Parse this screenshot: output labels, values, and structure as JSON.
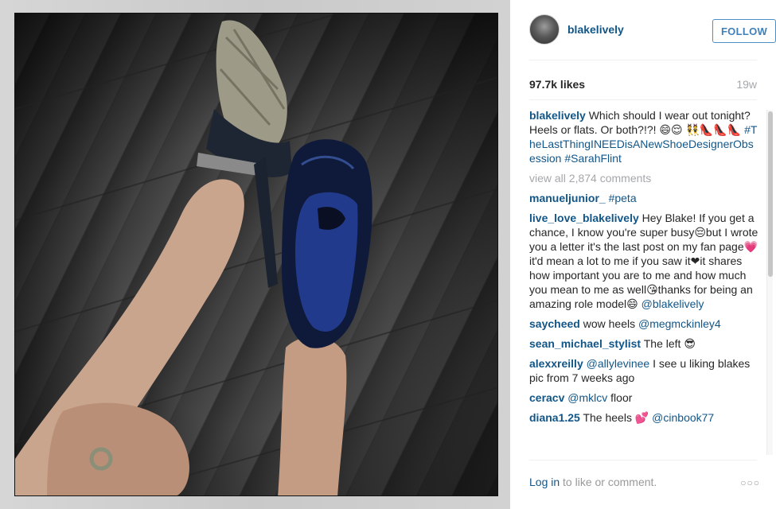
{
  "post": {
    "username": "blakelively",
    "follow_label": "FOLLOW",
    "likes": "97.7k likes",
    "age": "19w"
  },
  "caption": {
    "username": "blakelively",
    "text": "Which should I wear out tonight? Heels or flats. Or both?!?!",
    "emoji": "😄😌 👯👠👠👠",
    "hashtags": "#TheLastThingINEEDisANewShoeDesignerObsession #SarahFlint"
  },
  "view_all": "view all 2,874 comments",
  "comments": [
    {
      "user": "manueljunior_",
      "mention": "#peta",
      "text": ""
    },
    {
      "user": "live_love_blakelively",
      "mention": "",
      "text": "Hey Blake! If you get a chance, I know you're super busy😔but I wrote you a letter it's the last post on my fan page💗it'd mean a lot to me if you saw it❤it shares how important you are to me and how much you mean to me as well😘thanks for being an amazing role model😄"
    },
    {
      "user": "saycheed",
      "mention": "@megmckinley4",
      "text": "wow heels"
    },
    {
      "user": "sean_michael_stylist",
      "mention": "",
      "text": "The left 😎"
    },
    {
      "user": "alexxreilly",
      "mention": "@allylevinee",
      "text": "I see u liking blakes pic from 7 weeks ago"
    },
    {
      "user": "ceracv",
      "mention": "@mklcv",
      "text": "floor"
    },
    {
      "user": "diana1.25",
      "mention": "@cinbook77",
      "text": "The heels 💕"
    }
  ],
  "live_love_tail_mention": "@blakelively",
  "footer": {
    "login": "Log in",
    "rest": " to like or comment.",
    "more": "○○○"
  },
  "icons": {
    "more": "ellipsis-icon"
  },
  "colors": {
    "link": "#125688",
    "muted": "#a5a7aa",
    "follow_border": "#4a90c8"
  }
}
